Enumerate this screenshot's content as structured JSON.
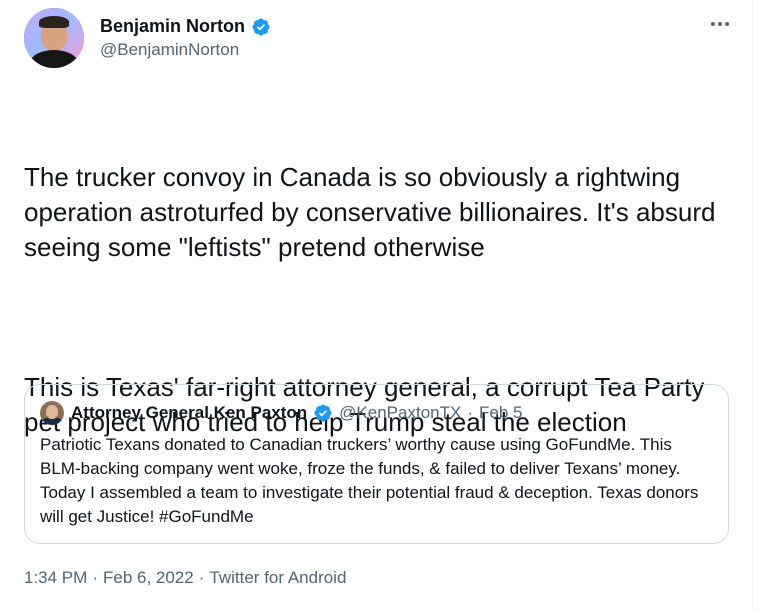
{
  "author": {
    "display_name": "Benjamin Norton",
    "handle": "@BenjaminNorton"
  },
  "tweet": {
    "paragraphs": [
      "The trucker convoy in Canada is so obviously a rightwing operation astroturfed by conservative billionaires. It's absurd seeing some \"leftists\" pretend otherwise",
      "This is Texas' far-right attorney general, a corrupt Tea Party pet project who tried to help Trump steal the election"
    ]
  },
  "quoted_tweet": {
    "display_name": "Attorney General Ken Paxton",
    "handle": "@KenPaxtonTX",
    "separator": "·",
    "date": "Feb 5",
    "text": "Patriotic Texans donated to Canadian truckers’ worthy cause using GoFundMe. This BLM-backing company went woke, froze the funds, &  failed to deliver Texans’ money. Today I assembled a team to investigate their potential fraud & deception. Texas donors will get Justice! #GoFundMe"
  },
  "meta": {
    "time": "1:34 PM",
    "sep1": "·",
    "date": "Feb 6, 2022",
    "sep2": "·",
    "source": "Twitter for Android"
  },
  "icons": {
    "verified": "verified-badge-icon",
    "more": "more-options-icon"
  },
  "colors": {
    "verified_blue": "#1d9bf0",
    "secondary_text": "#536471",
    "primary_text": "#0f1419",
    "border": "#cfd9de"
  }
}
